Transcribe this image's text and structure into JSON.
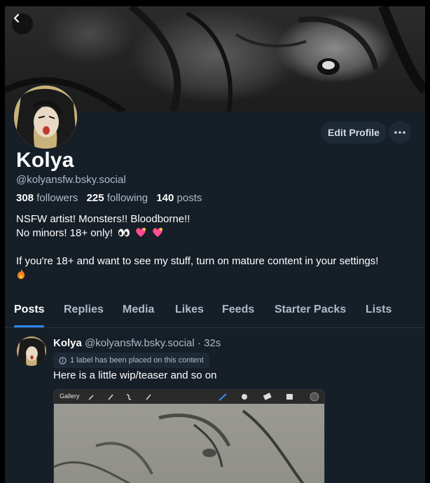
{
  "profile": {
    "display_name": "Kolya",
    "handle": "@kolyansfw.bsky.social",
    "followers_count": "308",
    "followers_label": "followers",
    "following_count": "225",
    "following_label": "following",
    "posts_count": "140",
    "posts_label": "posts",
    "bio_line1": "NSFW artist! Monsters!! Bloodborne!!",
    "bio_line2": "No minors! 18+ only!",
    "bio_line4": "If you're 18+ and want to see my stuff, turn on mature content in your settings!"
  },
  "actions": {
    "edit_profile_label": "Edit Profile"
  },
  "tabs": [
    {
      "label": "Posts",
      "active": true
    },
    {
      "label": "Replies"
    },
    {
      "label": "Media"
    },
    {
      "label": "Likes"
    },
    {
      "label": "Feeds"
    },
    {
      "label": "Starter Packs"
    },
    {
      "label": "Lists"
    }
  ],
  "post": {
    "author_name": "Kolya",
    "author_handle": "@kolyansfw.bsky.social",
    "separator": "·",
    "time": "32s",
    "label_notice": "1 label has been placed on this content",
    "text": "Here is a little wip/teaser and so on",
    "media_app_label": "Gallery"
  },
  "colors": {
    "accent": "#2f86f6",
    "background": "#161e27",
    "button_bg": "#1e2936",
    "muted_text": "#aebbc9"
  },
  "icons": {
    "back": "chevron-left-icon",
    "more": "ellipsis-icon",
    "label_info": "info-circle-icon",
    "emoji_eyes": "eyes-emoji",
    "emoji_heart": "sparkling-heart-emoji",
    "emoji_fire": "fire-emoji"
  }
}
